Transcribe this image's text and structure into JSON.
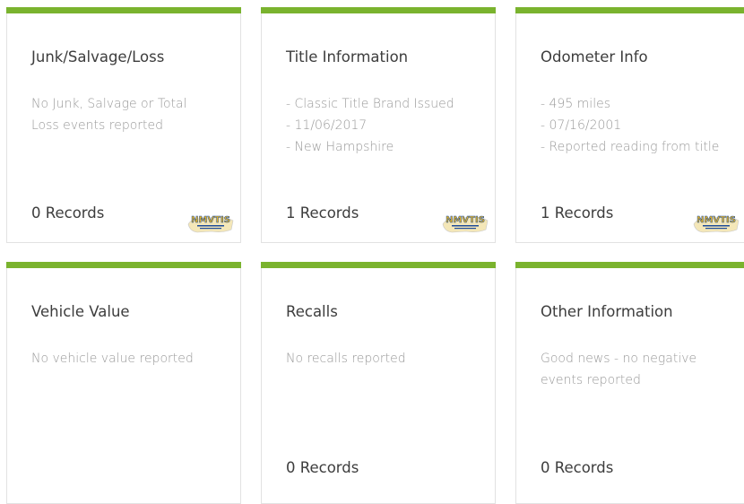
{
  "cards": [
    {
      "title": "Junk/Salvage/Loss",
      "lines": [
        "No Junk, Salvage or Total",
        "Loss events reported"
      ],
      "records": "0 Records",
      "logo": "NMVTIS"
    },
    {
      "title": "Title Information",
      "lines": [
        "- Classic Title Brand Issued",
        "- 11/06/2017",
        "- New Hampshire"
      ],
      "records": "1 Records",
      "logo": "NMVTIS"
    },
    {
      "title": "Odometer Info",
      "lines": [
        "- 495 miles",
        "- 07/16/2001",
        "- Reported reading from title"
      ],
      "records": "1 Records",
      "logo": "NMVTIS"
    },
    {
      "title": "Vehicle Value",
      "lines": [
        "No vehicle value reported"
      ],
      "records": ""
    },
    {
      "title": "Recalls",
      "lines": [
        "No recalls reported"
      ],
      "records": "0 Records"
    },
    {
      "title": "Other Information",
      "lines": [
        "Good news - no negative",
        "events reported"
      ],
      "records": "0 Records"
    }
  ],
  "colors": {
    "accent_bar": "#7ab32e",
    "title_text": "#3d3d3d",
    "body_text": "#9a9a9a",
    "logo_gold": "#e0b22a",
    "logo_blue": "#1f4d9a"
  }
}
